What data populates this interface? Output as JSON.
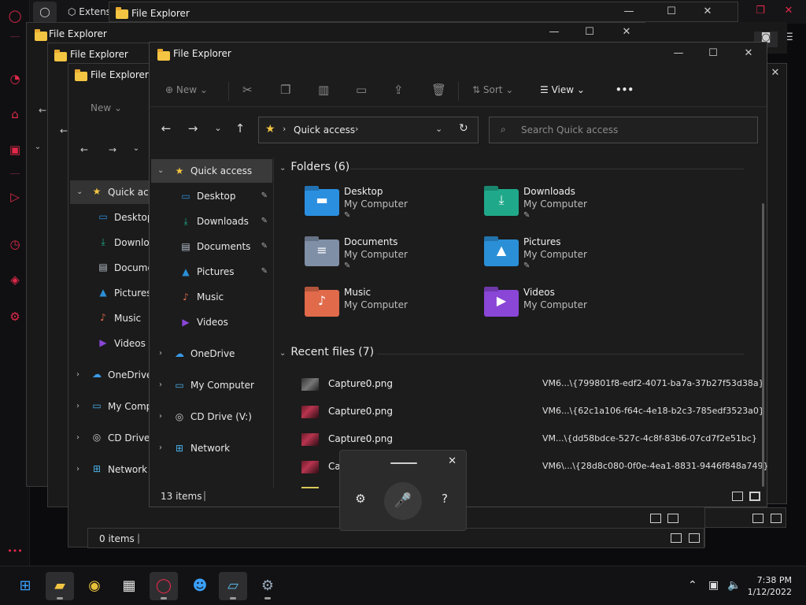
{
  "browser": {
    "tab_label": "Extens",
    "window_title": "File Explorer"
  },
  "windows": {
    "w1_title": "File Explorer",
    "w2_title": "File Explorer",
    "w3_title": "File Explorer"
  },
  "w3": {
    "new_label": "New",
    "nav": {
      "quick_access": "Quick acc",
      "desktop": "Desktop",
      "downloads": "Downloa",
      "documents": "Docume",
      "pictures": "Pictures",
      "music": "Music",
      "videos": "Videos",
      "onedrive": "OneDrive",
      "my_computer": "My Comp",
      "cd_drive": "CD Drive (",
      "network": "Network"
    },
    "status": "0 items"
  },
  "main": {
    "title": "File Explorer",
    "toolbar": {
      "new": "New",
      "sort": "Sort",
      "view": "View",
      "more": "•••"
    },
    "address": {
      "location": "Quick access"
    },
    "search": {
      "placeholder": "Search Quick access"
    },
    "nav": {
      "quick_access": "Quick access",
      "desktop": "Desktop",
      "downloads": "Downloads",
      "documents": "Documents",
      "pictures": "Pictures",
      "music": "Music",
      "videos": "Videos",
      "onedrive": "OneDrive",
      "my_computer": "My Computer",
      "cd_drive": "CD Drive (V:)",
      "network": "Network"
    },
    "folders_header": "Folders (6)",
    "folders": [
      {
        "name": "Desktop",
        "location": "My Computer"
      },
      {
        "name": "Downloads",
        "location": "My Computer"
      },
      {
        "name": "Documents",
        "location": "My Computer"
      },
      {
        "name": "Pictures",
        "location": "My Computer"
      },
      {
        "name": "Music",
        "location": "My Computer"
      },
      {
        "name": "Videos",
        "location": "My Computer"
      }
    ],
    "recent_header": "Recent files (7)",
    "recent": [
      {
        "name": "Capture0.png",
        "path": "VM6...\\{799801f8-edf2-4071-ba7a-37b27f53d38a}"
      },
      {
        "name": "Capture0.png",
        "path": "VM6...\\{62c1a106-f64c-4e18-b2c3-785edf3523a0}"
      },
      {
        "name": "Capture0.png",
        "path": "VM...\\{dd58bdce-527c-4c8f-83b6-07cd7f2e51bc}"
      },
      {
        "name": "Ca",
        "path": "VM6\\...\\{28d8c080-0f0e-4ea1-8831-9446f848a749}"
      }
    ],
    "status": "13 items"
  },
  "taskbar": {
    "time": "7:38 PM",
    "date": "1/12/2022"
  },
  "colors": {
    "opera_red": "#e0294a",
    "folder_yellow": "#f4c542",
    "desktop_blue": "#2b8fe0",
    "downloads_teal": "#1fa98a",
    "documents_gray": "#7f8fa6",
    "pictures_blue": "#2a8fd6",
    "music_orange": "#e06a4a",
    "videos_purple": "#8a46d6"
  }
}
